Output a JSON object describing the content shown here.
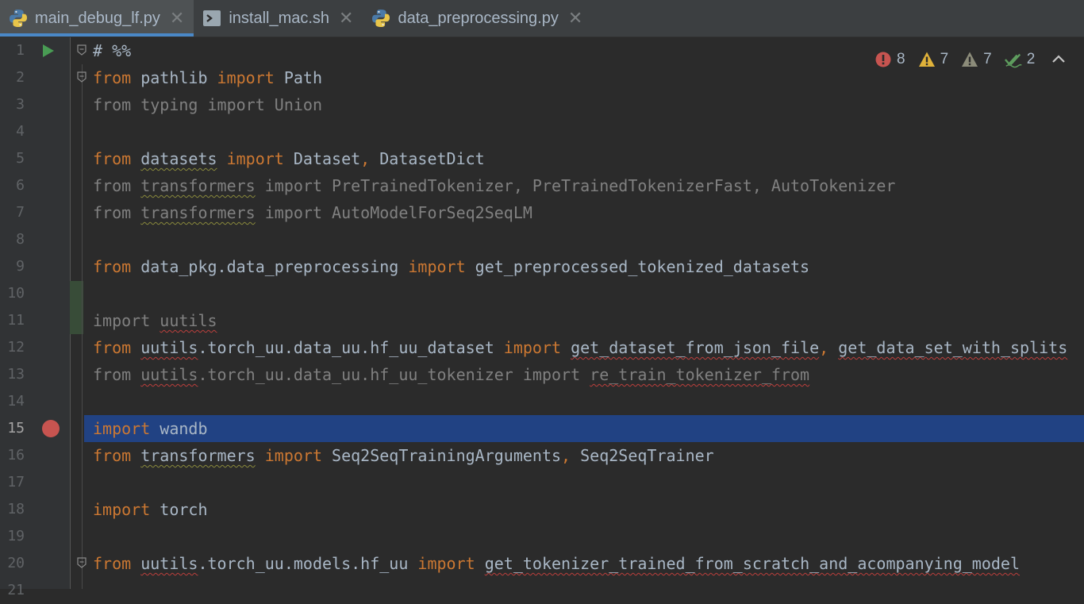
{
  "tabs": [
    {
      "label": "main_debug_lf.py",
      "icon": "python-file-icon",
      "active": true
    },
    {
      "label": "install_mac.sh",
      "icon": "shell-script-icon",
      "active": false
    },
    {
      "label": "data_preprocessing.py",
      "icon": "python-file-icon",
      "active": false
    }
  ],
  "inspections": {
    "errors": "8",
    "warnings": "7",
    "weak_warnings": "7",
    "typos": "2"
  },
  "current_line": 15,
  "lines": [
    {
      "n": "1",
      "tokens": [
        {
          "t": "# %%",
          "c": "cm"
        }
      ]
    },
    {
      "n": "2",
      "tokens": [
        {
          "t": "from",
          "c": "kw"
        },
        {
          "t": " pathlib ",
          "c": "tx"
        },
        {
          "t": "import",
          "c": "kw"
        },
        {
          "t": " Path",
          "c": "tx"
        }
      ]
    },
    {
      "n": "3",
      "tokens": [
        {
          "t": "from typing import Union",
          "c": "tx-dim"
        }
      ]
    },
    {
      "n": "4",
      "tokens": []
    },
    {
      "n": "5",
      "tokens": [
        {
          "t": "from",
          "c": "kw"
        },
        {
          "t": " ",
          "c": "tx"
        },
        {
          "t": "datasets",
          "c": "tx wv-y"
        },
        {
          "t": " ",
          "c": "tx"
        },
        {
          "t": "import",
          "c": "kw"
        },
        {
          "t": " Dataset",
          "c": "tx"
        },
        {
          "t": ",",
          "c": "pn"
        },
        {
          "t": " DatasetDict",
          "c": "tx"
        }
      ]
    },
    {
      "n": "6",
      "tokens": [
        {
          "t": "from ",
          "c": "tx-dim"
        },
        {
          "t": "transformers",
          "c": "tx-dim wv-y"
        },
        {
          "t": " import PreTrainedTokenizer, PreTrainedTokenizerFast, AutoTokenizer",
          "c": "tx-dim"
        }
      ]
    },
    {
      "n": "7",
      "tokens": [
        {
          "t": "from ",
          "c": "tx-dim"
        },
        {
          "t": "transformers",
          "c": "tx-dim wv-y"
        },
        {
          "t": " import AutoModelForSeq2SeqLM",
          "c": "tx-dim"
        }
      ]
    },
    {
      "n": "8",
      "tokens": []
    },
    {
      "n": "9",
      "tokens": [
        {
          "t": "from",
          "c": "kw"
        },
        {
          "t": " data_pkg.data_preprocessing ",
          "c": "tx"
        },
        {
          "t": "import",
          "c": "kw"
        },
        {
          "t": " get_preprocessed_tokenized_datasets",
          "c": "tx"
        }
      ]
    },
    {
      "n": "10",
      "tokens": []
    },
    {
      "n": "11",
      "tokens": [
        {
          "t": "import ",
          "c": "tx-dim"
        },
        {
          "t": "uutils",
          "c": "tx-dim wv-r"
        }
      ]
    },
    {
      "n": "12",
      "tokens": [
        {
          "t": "from",
          "c": "kw"
        },
        {
          "t": " ",
          "c": "tx"
        },
        {
          "t": "uutils",
          "c": "tx wv-r"
        },
        {
          "t": ".torch_uu.data_uu.hf_uu_dataset ",
          "c": "tx"
        },
        {
          "t": "import",
          "c": "kw"
        },
        {
          "t": " ",
          "c": "tx"
        },
        {
          "t": "get_dataset_from_json_file",
          "c": "tx wv-r"
        },
        {
          "t": ",",
          "c": "pn"
        },
        {
          "t": " ",
          "c": "tx"
        },
        {
          "t": "get_data_set_with_splits",
          "c": "tx wv-r"
        }
      ]
    },
    {
      "n": "13",
      "tokens": [
        {
          "t": "from ",
          "c": "tx-dim"
        },
        {
          "t": "uutils",
          "c": "tx-dim wv-r"
        },
        {
          "t": ".torch_uu.data_uu.hf_uu_tokenizer import ",
          "c": "tx-dim"
        },
        {
          "t": "re_train_tokenizer_from",
          "c": "tx-dim wv-r"
        }
      ]
    },
    {
      "n": "14",
      "tokens": []
    },
    {
      "n": "15",
      "tokens": [
        {
          "t": "import",
          "c": "kw"
        },
        {
          "t": " wandb",
          "c": "tx"
        }
      ]
    },
    {
      "n": "16",
      "tokens": [
        {
          "t": "from",
          "c": "kw"
        },
        {
          "t": " ",
          "c": "tx"
        },
        {
          "t": "transformers",
          "c": "tx wv-y"
        },
        {
          "t": " ",
          "c": "tx"
        },
        {
          "t": "import",
          "c": "kw"
        },
        {
          "t": " Seq2SeqTrainingArguments",
          "c": "tx"
        },
        {
          "t": ",",
          "c": "pn"
        },
        {
          "t": " Seq2SeqTrainer",
          "c": "tx"
        }
      ]
    },
    {
      "n": "17",
      "tokens": []
    },
    {
      "n": "18",
      "tokens": [
        {
          "t": "import",
          "c": "kw"
        },
        {
          "t": " torch",
          "c": "tx"
        }
      ]
    },
    {
      "n": "19",
      "tokens": []
    },
    {
      "n": "20",
      "tokens": [
        {
          "t": "from",
          "c": "kw"
        },
        {
          "t": " ",
          "c": "tx"
        },
        {
          "t": "uutils",
          "c": "tx wv-r"
        },
        {
          "t": ".torch_uu.models.hf_uu ",
          "c": "tx"
        },
        {
          "t": "import",
          "c": "kw"
        },
        {
          "t": " ",
          "c": "tx"
        },
        {
          "t": "get_tokenizer_trained_from_scratch_and_acompanying_model",
          "c": "tx wv-r"
        }
      ]
    },
    {
      "n": "21",
      "tokens": []
    }
  ]
}
